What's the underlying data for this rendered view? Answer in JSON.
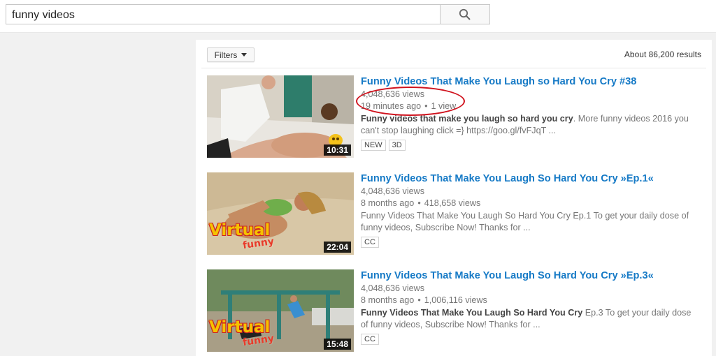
{
  "search": {
    "query": "funny videos"
  },
  "filters": {
    "label": "Filters"
  },
  "result_count": "About 86,200 results",
  "colors": {
    "title_link": "#167ac6",
    "annotation": "#d0131e"
  },
  "videos": [
    {
      "title": "Funny Videos That Make You Laugh so Hard You Cry #38",
      "views": "4,048,636 views",
      "age": "19 minutes ago",
      "views2": "1 view",
      "desc_bold": "Funny videos that make you laugh so hard you cry",
      "desc_rest": ". More funny videos 2016 you can't stop laughing click =} https://goo.gl/fvFJqT ...",
      "duration": "10:31",
      "badges": [
        "NEW",
        "3D"
      ]
    },
    {
      "title": "Funny Videos That Make You Laugh So Hard You Cry »Ep.1«",
      "views": "4,048,636 views",
      "age": "8 months ago",
      "views2": "418,658 views",
      "desc_bold": "",
      "desc_rest": "Funny Videos That Make You Laugh So Hard You Cry Ep.1 To get your daily dose of funny videos, Subscribe Now! Thanks for ...",
      "duration": "22:04",
      "badges": [
        "CC"
      ],
      "logo_text": [
        "Virtual",
        "funny"
      ]
    },
    {
      "title": "Funny Videos That Make You Laugh So Hard You Cry »Ep.3«",
      "views": "4,048,636 views",
      "age": "8 months ago",
      "views2": "1,006,116 views",
      "desc_bold": "Funny Videos That Make You Laugh So Hard You Cry",
      "desc_rest": " Ep.3 To get your daily dose of funny videos, Subscribe Now! Thanks for ...",
      "duration": "15:48",
      "badges": [
        "CC"
      ],
      "logo_text": [
        "Virtual",
        "funny"
      ]
    }
  ],
  "icons": {
    "search": "search-icon",
    "filter_caret": "chevron-down-icon"
  }
}
